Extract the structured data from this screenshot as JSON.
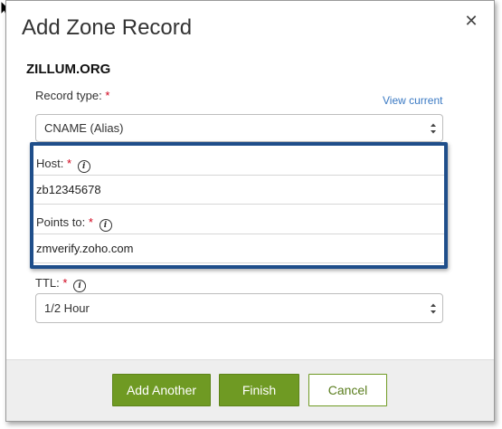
{
  "dialog": {
    "title": "Add Zone Record",
    "close_icon": "close-icon",
    "domain": "ZILLUM.ORG"
  },
  "record_type": {
    "label": "Record type:",
    "required_mark": "*",
    "view_current": "View current",
    "selected": "CNAME (Alias)"
  },
  "host": {
    "label": "Host:",
    "required_mark": "*",
    "info_icon": "info-icon",
    "value": "zb12345678"
  },
  "points_to": {
    "label": "Points to:",
    "required_mark": "*",
    "info_icon": "info-icon",
    "value": "zmverify.zoho.com"
  },
  "ttl": {
    "label": "TTL:",
    "required_mark": "*",
    "info_icon": "info-icon",
    "selected": "1/2 Hour"
  },
  "footer": {
    "add_another": "Add Another",
    "finish": "Finish",
    "cancel": "Cancel"
  },
  "colors": {
    "accent_green": "#6f9a23",
    "highlight_blue": "#1f4e8a",
    "link_blue": "#3a79c3",
    "required_red": "#d0021b"
  }
}
